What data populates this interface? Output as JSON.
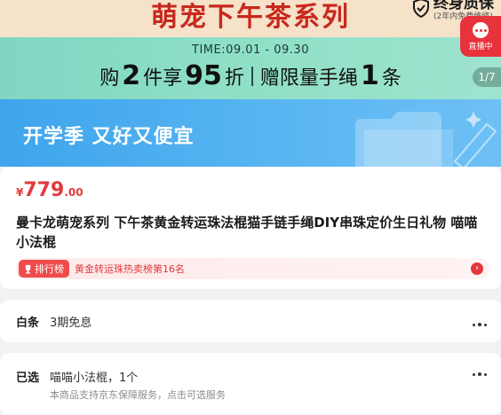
{
  "banner": {
    "series_title": "萌宠下午茶系列",
    "warranty": {
      "main": "终身质保",
      "sub": "(2年内免费维修)"
    },
    "promo": {
      "time": "TIME:09.01 - 09.30",
      "part1": "购",
      "count": "2",
      "part2": "件享",
      "discount": "95",
      "part3": "折",
      "part4": "赠限量手绳",
      "gift_count": "1",
      "part5": "条"
    },
    "live_label": "直播中",
    "page_indicator": "1/7",
    "school_text": "开学季  又好又便宜"
  },
  "product": {
    "price": {
      "currency": "¥",
      "integer": "779",
      "decimal": ".00"
    },
    "title": "曼卡龙萌宠系列 下午茶黄金转运珠法棍猫手链手绳DIY串珠定价生日礼物 喵喵小法棍",
    "rank": {
      "badge": "排行榜",
      "text": "黄金转运珠热卖榜第16名"
    }
  },
  "rows": {
    "baitiao": {
      "label": "白条",
      "value": "3期免息"
    },
    "selected": {
      "label": "已选",
      "value": "喵喵小法棍，1个",
      "sub": "本商品支持京东保障服务，点击可选服务"
    }
  },
  "colors": {
    "brand_red": "#e4393c",
    "mint": "#8edfc6",
    "blue": "#4aaced"
  }
}
